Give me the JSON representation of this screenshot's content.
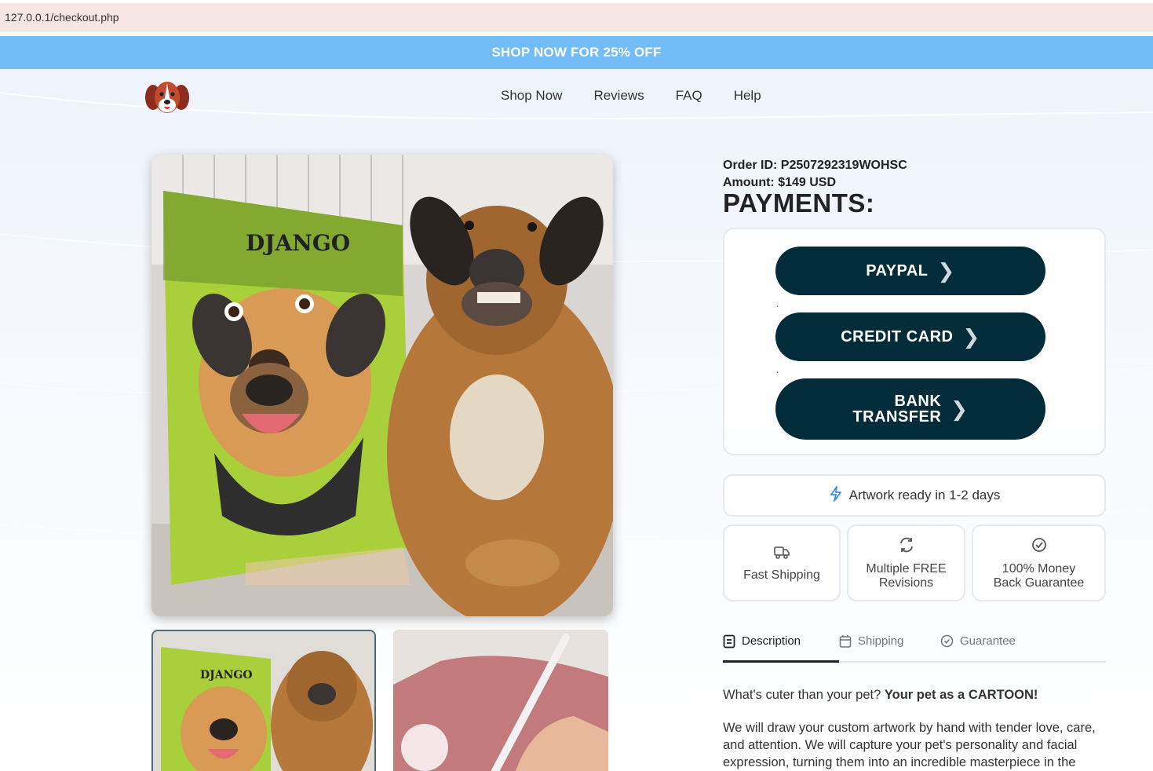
{
  "browser": {
    "url": "127.0.0.1/checkout.php"
  },
  "promo": {
    "text": "SHOP NOW FOR 25% OFF"
  },
  "nav": {
    "items": [
      "Shop Now",
      "Reviews",
      "FAQ",
      "Help"
    ]
  },
  "order": {
    "id_line": "Order ID: P2507292319WOHSC",
    "amount_line": "Amount: $149 USD"
  },
  "payments": {
    "title": "PAYMENTS:",
    "paypal": "PAYPAL",
    "credit_card": "CREDIT CARD",
    "bank_line1": "BANK",
    "bank_line2": "TRANSFER",
    "separator": "."
  },
  "ready": {
    "text": "Artwork ready in 1-2 days"
  },
  "features": {
    "shipping": "Fast Shipping",
    "revisions_l1": "Multiple FREE",
    "revisions_l2": "Revisions",
    "guarantee_l1": "100% Money",
    "guarantee_l2": "Back Guarantee"
  },
  "tabs": {
    "description": "Description",
    "shipping": "Shipping",
    "guarantee": "Guarantee"
  },
  "description": {
    "lead": "What's cuter than your pet? ",
    "lead_bold": "Your pet as a CARTOON!",
    "body": "We will draw your custom artwork by hand with tender love, care, and attention. We will capture your pet's personality and facial expression, turning them into an incredible masterpiece in the"
  },
  "artwork": {
    "name": "DJANGO"
  },
  "colors": {
    "accent": "#72bdf7",
    "button": "#022c3a"
  }
}
